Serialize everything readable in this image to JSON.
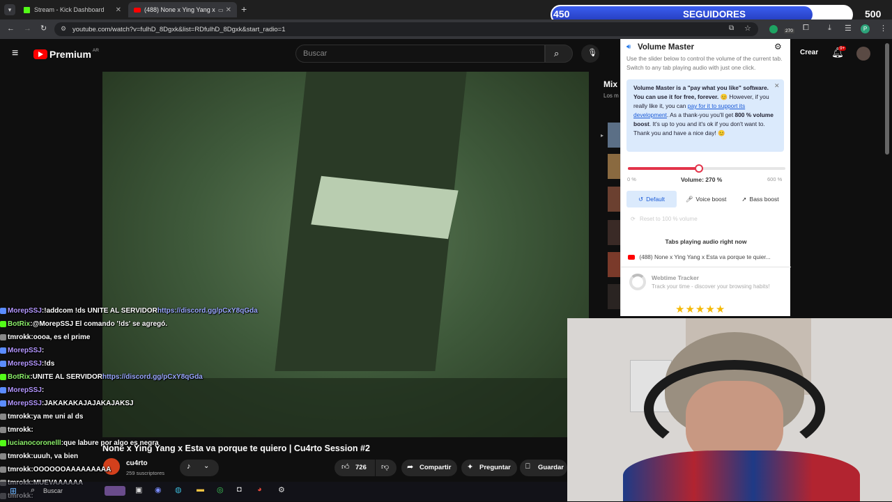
{
  "tabs": [
    {
      "label": "Stream - Kick Dashboard"
    },
    {
      "label": "(488) None x Ying Yang x E..."
    }
  ],
  "address": {
    "url": "youtube.com/watch?v=fulhD_8Dgxk&list=RDfulhD_8Dgxk&start_radio=1"
  },
  "youtube": {
    "logo": "Premium",
    "region": "AR",
    "search_placeholder": "Buscar",
    "create_label": "Crear",
    "notif_count": "9+",
    "video_title": "None x Ying Yang x Esta va porque te quiero | Cu4rto Session #2",
    "channel_name": "cu4rto",
    "subscribers": "259 suscriptores",
    "likes": "726",
    "share_label": "Compartir",
    "ask_label": "Preguntar",
    "save_label": "Guardar",
    "mix_label": "Mix",
    "mix_sub": "Los m"
  },
  "counter": {
    "left": "450",
    "center": "SEGUIDORES",
    "right": "500",
    "progress": 0.87
  },
  "extension_badge": "270",
  "volume_master": {
    "title": "Volume Master",
    "desc": "Use the slider below to control the volume of the current tab. Switch to any tab playing audio with just one click.",
    "info_bold1": "Volume Master is a \"pay what you like\" software. You can use it for free, forever.",
    "info_text1": "However, if you really like it, you can",
    "info_link": "pay for it to support its development",
    "info_text2": ". As a thank-you you'll get",
    "info_bold2": "800 % volume boost",
    "info_text3": ". It's up to you and it's ok if you don't want to. Thank you and have a nice day!",
    "min_label": "0 %",
    "volume_label": "Volume: 270 %",
    "max_label": "600 %",
    "volume_fraction": 0.45,
    "default_label": "Default",
    "voice_label": "Voice boost",
    "bass_label": "Bass boost",
    "reset_label": "Reset to 100 % volume",
    "tabs_heading": "Tabs playing audio right now",
    "tab_item": "(488) None x Ying Yang x Esta va porque te quier...",
    "promo_title": "Webtime Tracker",
    "promo_sub": "Track your time - discover your browsing habits!",
    "rating_stars": 5
  },
  "chat": [
    {
      "user": "MorepSSJ",
      "sep": " : ",
      "text": "!addcom !ds UNITE AL SERVIDOR ",
      "link": "https://discord.gg/pCxY8qGda",
      "ucolor": "p"
    },
    {
      "user": "BotRix",
      "sep": " : ",
      "text": "@MorepSSJ El comando '!ds' se agregó.",
      "link": "",
      "ucolor": "g"
    },
    {
      "user": "tmrokk",
      "sep": " : ",
      "text": "oooa, es el prime",
      "link": "",
      "ucolor": "w"
    },
    {
      "user": "MorepSSJ",
      "sep": " : ",
      "text": "",
      "link": "",
      "ucolor": "p"
    },
    {
      "user": "MorepSSJ",
      "sep": " : ",
      "text": "!ds",
      "link": "",
      "ucolor": "p"
    },
    {
      "user": "BotRix",
      "sep": " : ",
      "text": "UNITE AL SERVIDOR ",
      "link": "https://discord.gg/pCxY8qGda",
      "ucolor": "g"
    },
    {
      "user": "MorepSSJ",
      "sep": " : ",
      "text": "",
      "link": "",
      "ucolor": "p"
    },
    {
      "user": "MorepSSJ",
      "sep": " : ",
      "text": "JAKAKAKAJAJAKAJAKSJ",
      "link": "",
      "ucolor": "p"
    },
    {
      "user": "tmrokk",
      "sep": " : ",
      "text": "ya me uni al ds",
      "link": "",
      "ucolor": "w"
    },
    {
      "user": "tmrokk",
      "sep": " : ",
      "text": "",
      "link": "",
      "ucolor": "w"
    },
    {
      "user": "lucianocoronelll",
      "sep": " : ",
      "text": "que labure por algo es negra",
      "link": "",
      "ucolor": "g"
    },
    {
      "user": "tmrokk",
      "sep": " : ",
      "text": "uuuh, va bien",
      "link": "",
      "ucolor": "w"
    },
    {
      "user": "tmrokk",
      "sep": " : ",
      "text": "OOOOOOAAAAAAAAA",
      "link": "",
      "ucolor": "w"
    },
    {
      "user": "tmrokk",
      "sep": " : ",
      "text": "MUEVAAAAAA",
      "link": "",
      "ucolor": "w"
    },
    {
      "user": "tmrokk",
      "sep": " : ",
      "text": "",
      "link": "",
      "ucolor": "w"
    }
  ],
  "taskbar": {
    "search_placeholder": "Buscar"
  },
  "colors": {
    "accent": "#e3344a",
    "yt_red": "#ff0000",
    "counter_blue": "#2b48d6",
    "link_blue": "#1a5ad7"
  }
}
